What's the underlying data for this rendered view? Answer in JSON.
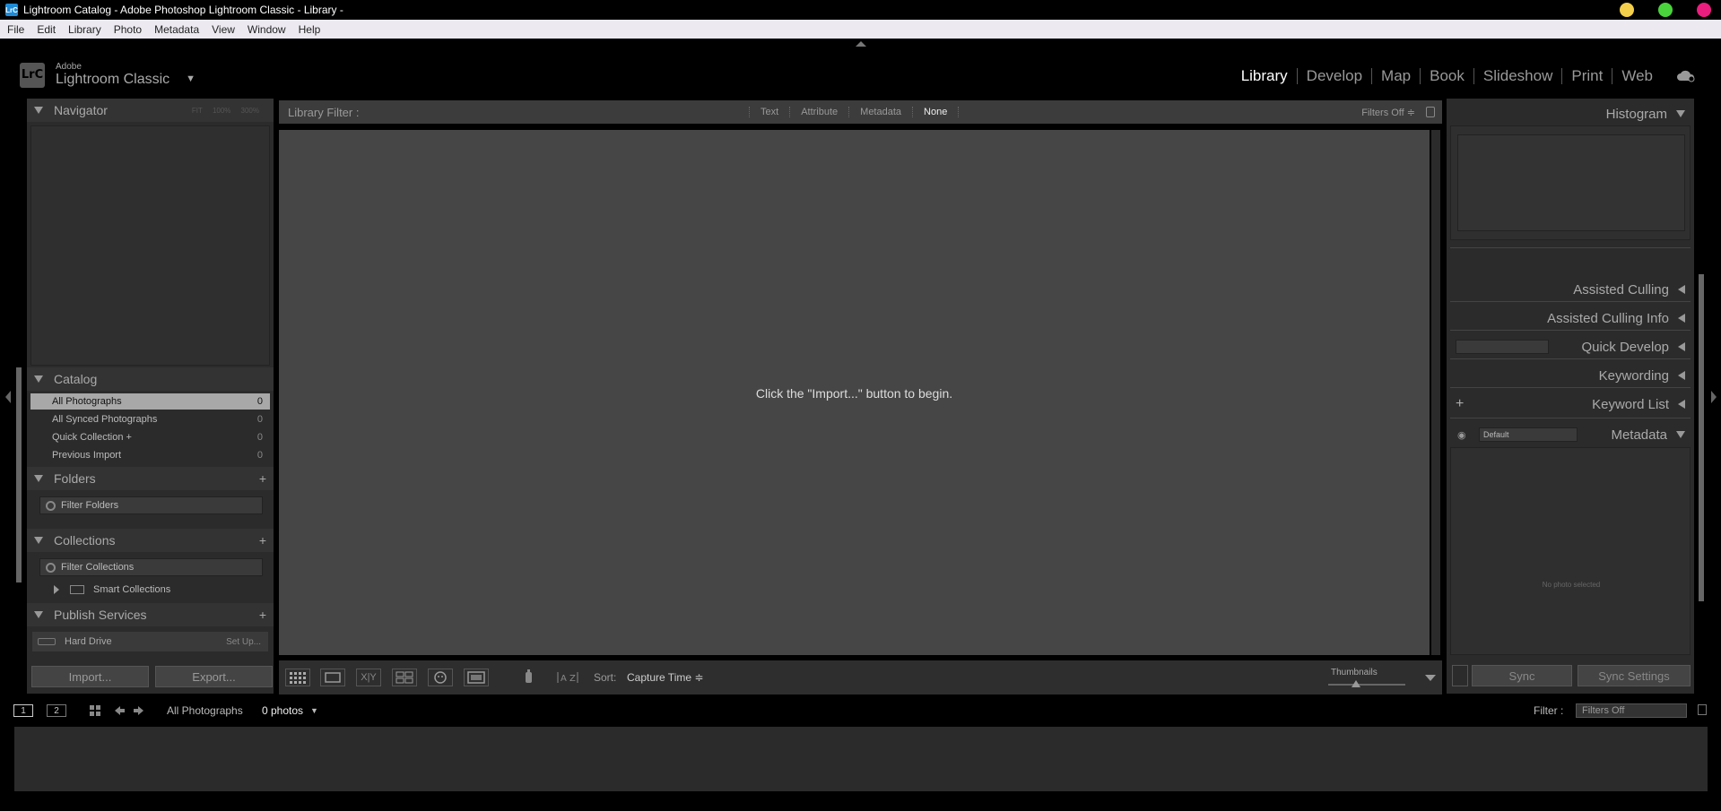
{
  "window": {
    "title": "Lightroom Catalog - Adobe Photoshop Lightroom Classic - Library -",
    "app_badge": "LrC"
  },
  "menu": [
    "File",
    "Edit",
    "Library",
    "Photo",
    "Metadata",
    "View",
    "Window",
    "Help"
  ],
  "identity": {
    "logo": "LrC",
    "brand": "Adobe",
    "product": "Lightroom Classic",
    "caret": "▼"
  },
  "modules": {
    "items": [
      {
        "label": "Library",
        "active": true
      },
      {
        "label": "Develop"
      },
      {
        "label": "Map"
      },
      {
        "label": "Book"
      },
      {
        "label": "Slideshow"
      },
      {
        "label": "Print"
      },
      {
        "label": "Web"
      }
    ],
    "cloud_icon": "cloud-sync-icon"
  },
  "navigator": {
    "title": "Navigator",
    "zoom": [
      "FIT",
      "100%",
      "300%"
    ]
  },
  "catalog": {
    "title": "Catalog",
    "items": [
      {
        "label": "All Photographs",
        "count": "0"
      },
      {
        "label": "All Synced Photographs",
        "count": "0"
      },
      {
        "label": "Quick Collection  +",
        "count": "0"
      },
      {
        "label": "Previous Import",
        "count": "0"
      }
    ]
  },
  "folders": {
    "title": "Folders",
    "plus": "+",
    "filter": "Filter Folders"
  },
  "collections": {
    "title": "Collections",
    "plus": "+",
    "filter": "Filter Collections",
    "smart": "Smart Collections"
  },
  "publish": {
    "title": "Publish Services",
    "plus": "+",
    "service": "Hard Drive",
    "setup": "Set Up..."
  },
  "buttons": {
    "import": "Import...",
    "export": "Export..."
  },
  "filterbar": {
    "label": "Library Filter :",
    "tabs": [
      "Text",
      "Attribute",
      "Metadata",
      "None"
    ],
    "active_tab": "None",
    "status": "Filters Off ≑"
  },
  "grid": {
    "message": "Click the \"Import...\" button to begin."
  },
  "toolbar": {
    "sort_label": "Sort:",
    "sort_value": "Capture Time ≑",
    "thumbnails": "Thumbnails",
    "xy": "X|Y"
  },
  "right": {
    "histogram": "Histogram",
    "sections": [
      "Assisted Culling",
      "Assisted Culling Info",
      "Quick Develop",
      "Keywording",
      "Keyword List",
      "Metadata"
    ],
    "metadata_preset": "Default",
    "no_photo": "No photo selected",
    "sync": "Sync",
    "sync_settings": "Sync Settings"
  },
  "filmstrip": {
    "view1": "1",
    "view2": "2",
    "source": "All Photographs",
    "count": "0 photos",
    "filter_label": "Filter :",
    "filter_value": "Filters Off"
  }
}
